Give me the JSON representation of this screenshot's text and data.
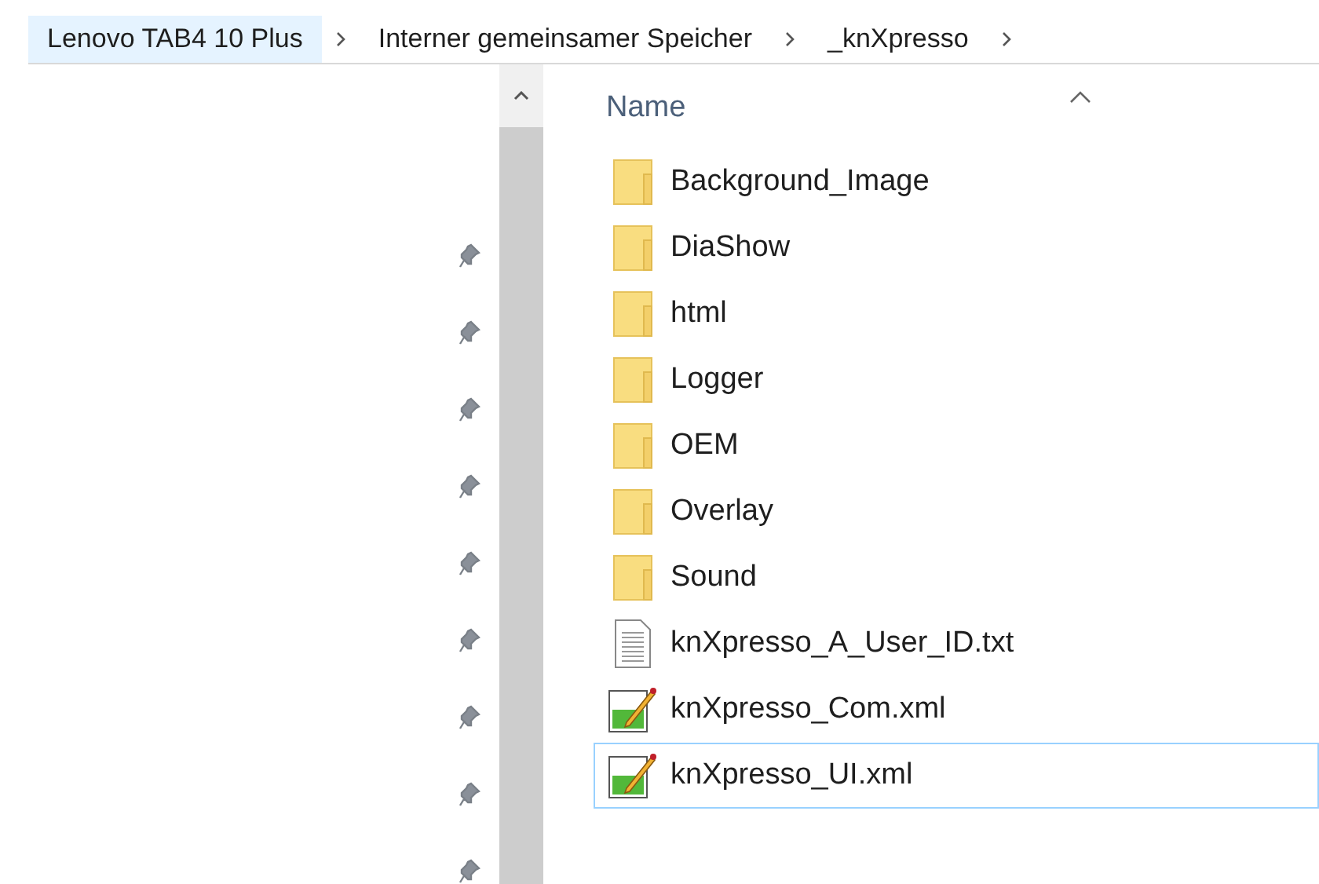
{
  "breadcrumb": [
    {
      "label": "Lenovo TAB4 10 Plus",
      "highlighted": true
    },
    {
      "label": "Interner gemeinsamer Speicher",
      "highlighted": false
    },
    {
      "label": "_knXpresso",
      "highlighted": false
    }
  ],
  "column_header": {
    "label": "Name"
  },
  "files": [
    {
      "name": "Background_Image",
      "kind": "folder",
      "selected": false
    },
    {
      "name": "DiaShow",
      "kind": "folder",
      "selected": false
    },
    {
      "name": "html",
      "kind": "folder",
      "selected": false
    },
    {
      "name": "Logger",
      "kind": "folder",
      "selected": false
    },
    {
      "name": "OEM",
      "kind": "folder",
      "selected": false
    },
    {
      "name": "Overlay",
      "kind": "folder",
      "selected": false
    },
    {
      "name": "Sound",
      "kind": "folder",
      "selected": false
    },
    {
      "name": "knXpresso_A_User_ID.txt",
      "kind": "text",
      "selected": false
    },
    {
      "name": "knXpresso_Com.xml",
      "kind": "xml",
      "selected": false
    },
    {
      "name": "knXpresso_UI.xml",
      "kind": "xml",
      "selected": true
    }
  ]
}
